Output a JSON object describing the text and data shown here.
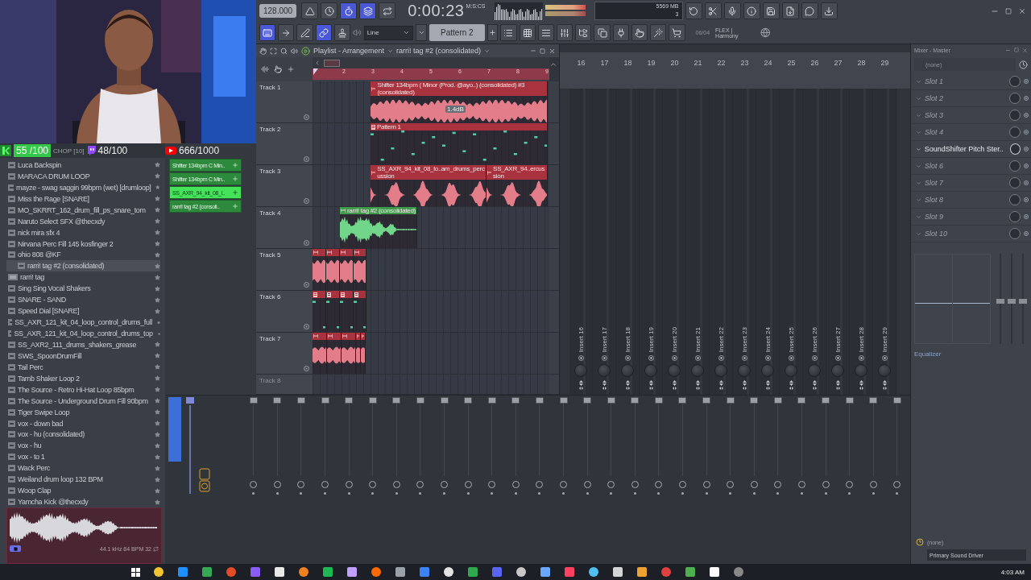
{
  "stats": {
    "kick_count": "55 /100",
    "hidden_label": "CHOP [10]",
    "twitch_count": "48/100",
    "youtube_count": "666/1000"
  },
  "toolbar": {
    "tempo": "128.000",
    "time": "0:00:23",
    "time_format": "M:S:CS",
    "cpu": "5",
    "memory": "569 MB",
    "polyphony": "3",
    "snap": "Line",
    "pattern": "Pattern 2",
    "news_date": "06/04",
    "news_text": "FLEX | Harmony",
    "row1_buttons": [
      {
        "kind": "metronome",
        "on": false
      },
      {
        "kind": "wait",
        "on": false
      },
      {
        "kind": "countdown",
        "on": true
      },
      {
        "kind": "overdub",
        "on": true
      },
      {
        "kind": "loop",
        "on": false
      }
    ],
    "row1_tools": [
      {
        "kind": "undo",
        "on": false
      },
      {
        "kind": "cut",
        "on": false
      },
      {
        "kind": "mic",
        "on": false
      },
      {
        "kind": "help",
        "on": false
      },
      {
        "kind": "save",
        "on": false
      },
      {
        "kind": "render",
        "on": false
      },
      {
        "kind": "chat",
        "on": false
      },
      {
        "kind": "download",
        "on": false
      }
    ],
    "row2_buttons": [
      {
        "kind": "keyboard",
        "on": true
      },
      {
        "kind": "step",
        "on": false
      },
      {
        "kind": "slide",
        "on": false
      },
      {
        "kind": "link",
        "on": true
      },
      {
        "kind": "stamp",
        "on": false
      }
    ],
    "row2_tools": [
      {
        "kind": "playlist",
        "on": false
      },
      {
        "kind": "piano_roll",
        "on": false
      },
      {
        "kind": "channel_rack",
        "on": false
      },
      {
        "kind": "mixer",
        "on": false
      },
      {
        "kind": "browser",
        "on": false
      },
      {
        "kind": "copy",
        "on": false
      },
      {
        "kind": "plug",
        "on": false
      },
      {
        "kind": "touch",
        "on": false
      },
      {
        "kind": "smart",
        "on": false
      },
      {
        "kind": "shop",
        "on": false
      }
    ]
  },
  "browser": {
    "items": [
      {
        "name": "Luca Backspin",
        "kind": "audio",
        "selected": false
      },
      {
        "name": "MARACA DRUM LOOP",
        "kind": "audio",
        "selected": false
      },
      {
        "name": "mayze - swag saggin 99bpm (wet) [drumloop]",
        "kind": "audio",
        "selected": false
      },
      {
        "name": "Miss the Rage [SNARE]",
        "kind": "audio",
        "selected": false
      },
      {
        "name": "MO_SKRRT_162_drum_fill_ps_snare_tom",
        "kind": "audio",
        "selected": false
      },
      {
        "name": "Naruto Select SFX @thecxdy",
        "kind": "audio",
        "selected": false
      },
      {
        "name": "nick mira sfx 4",
        "kind": "audio",
        "selected": false
      },
      {
        "name": "Nirvana Perc Fill 145 kosfinger 2",
        "kind": "audio",
        "selected": false
      },
      {
        "name": "ohio 808 @KF",
        "kind": "audio",
        "selected": false
      },
      {
        "name": "rarri! tag #2 (consolidated)",
        "kind": "audio",
        "selected": true
      },
      {
        "name": "rarri! tag",
        "kind": "mp3",
        "selected": false
      },
      {
        "name": "Sing Sing Vocal Shakers",
        "kind": "audio",
        "selected": false
      },
      {
        "name": "SNARE - SAND",
        "kind": "audio",
        "selected": false
      },
      {
        "name": "Speed Dial [SNARE]",
        "kind": "audio",
        "selected": false
      },
      {
        "name": "SS_AXR_121_kit_04_loop_control_drums_full",
        "kind": "audio",
        "selected": false
      },
      {
        "name": "SS_AXR_121_kit_04_loop_control_drums_top",
        "kind": "audio",
        "selected": false
      },
      {
        "name": "SS_AXR2_111_drums_shakers_grease",
        "kind": "audio",
        "selected": false
      },
      {
        "name": "SWS_SpoonDrumFill",
        "kind": "audio",
        "selected": false
      },
      {
        "name": "Tail Perc",
        "kind": "audio",
        "selected": false
      },
      {
        "name": "Tamb Shaker Loop 2",
        "kind": "audio",
        "selected": false
      },
      {
        "name": "The Source - Retro Hi-Hat Loop 85bpm",
        "kind": "audio",
        "selected": false
      },
      {
        "name": "The Source - Underground Drum Fill 90bpm",
        "kind": "audio",
        "selected": false
      },
      {
        "name": "Tiger Swipe Loop",
        "kind": "audio",
        "selected": false
      },
      {
        "name": "vox - down bad",
        "kind": "audio",
        "selected": false
      },
      {
        "name": "vox - hu (consolidated)",
        "kind": "audio",
        "selected": false
      },
      {
        "name": "vox - hu",
        "kind": "audio",
        "selected": false
      },
      {
        "name": "vox - to 1",
        "kind": "audio",
        "selected": false
      },
      {
        "name": "Wack Perc",
        "kind": "audio",
        "selected": false
      },
      {
        "name": "Weiland drum loop 132 BPM",
        "kind": "audio",
        "selected": false
      },
      {
        "name": "Woop Clap",
        "kind": "audio",
        "selected": false
      },
      {
        "name": "Yamcha Kick @thecxdy",
        "kind": "audio",
        "selected": false
      }
    ]
  },
  "preview": {
    "info": "44.1 kHz 84 BPM 32"
  },
  "channel_rack": {
    "clips": [
      {
        "label": "Shifter 134bpm C Min..",
        "selected": false
      },
      {
        "label": "Shifter 134bpm C Min..",
        "selected": false
      },
      {
        "label": "SS_AXR_94_kit_08_l..",
        "selected": true
      },
      {
        "label": "rarri! tag #2 (consoli..",
        "selected": false
      }
    ]
  },
  "playlist": {
    "title": "Playlist - Arrangement",
    "pattern": "rarri! tag #2 (consolidated)",
    "ruler": [
      "2",
      "3",
      "4",
      "5",
      "6",
      "7",
      "8",
      "9"
    ],
    "hint": "1.4dB",
    "tracks": [
      {
        "name": "Track 1",
        "clips": [
          {
            "kind": "audio",
            "label": "Shifter 134bpm ( Minor (Prod. @ayo..) (consolidated) #3 (consolidated)",
            "color": "#a8323e"
          }
        ]
      },
      {
        "name": "Track 2",
        "clips": [
          {
            "kind": "pattern",
            "label": "Pattern 1",
            "color": "#a8323e"
          }
        ]
      },
      {
        "name": "Track 3",
        "clips": [
          {
            "kind": "audio",
            "label": "SS_AXR_94_kit_08_lo..am_drums_percussion",
            "color": "#a8323e"
          },
          {
            "kind": "audio",
            "label": "SS_AXR_94..ercussion",
            "color": "#a8323e"
          }
        ]
      },
      {
        "name": "Track 4",
        "clips": [
          {
            "kind": "audio",
            "label": "rarri! tag #2 (consolidated)",
            "color": "#3f9a4c"
          }
        ]
      },
      {
        "name": "Track 5",
        "clips": [
          {
            "kind": "audio",
            "color": "#a8323e"
          },
          {
            "kind": "audio",
            "color": "#a8323e"
          },
          {
            "kind": "audio",
            "color": "#a8323e"
          },
          {
            "kind": "audio",
            "color": "#a8323e"
          }
        ]
      },
      {
        "name": "Track 6",
        "clips": [
          {
            "kind": "pattern",
            "color": "#a8323e"
          },
          {
            "kind": "pattern",
            "color": "#a8323e"
          },
          {
            "kind": "pattern",
            "color": "#a8323e"
          },
          {
            "kind": "pattern",
            "color": "#a8323e"
          }
        ]
      },
      {
        "name": "Track 7",
        "clips": [
          {
            "kind": "audio",
            "color": "#a8323e"
          },
          {
            "kind": "audio",
            "color": "#a8323e"
          },
          {
            "kind": "audio",
            "color": "#a8323e"
          },
          {
            "kind": "audio",
            "color": "#a8323e"
          },
          {
            "kind": "audio",
            "color": "#a8323e"
          }
        ]
      },
      {
        "name": "Track 8"
      }
    ]
  },
  "mixer": {
    "channels": [
      {
        "number": "16",
        "name": "Insert 16"
      },
      {
        "number": "17",
        "name": "Insert 17"
      },
      {
        "number": "18",
        "name": "Insert 18"
      },
      {
        "number": "19",
        "name": "Insert 19"
      },
      {
        "number": "20",
        "name": "Insert 20"
      },
      {
        "number": "21",
        "name": "Insert 21"
      },
      {
        "number": "22",
        "name": "Insert 22"
      },
      {
        "number": "23",
        "name": "Insert 23"
      },
      {
        "number": "24",
        "name": "Insert 24"
      },
      {
        "number": "25",
        "name": "Insert 25"
      },
      {
        "number": "26",
        "name": "Insert 26"
      },
      {
        "number": "27",
        "name": "Insert 27"
      },
      {
        "number": "28",
        "name": "Insert 28"
      },
      {
        "number": "29",
        "name": "Insert 29"
      }
    ]
  },
  "mixer_master": {
    "title": "Mixer - Master",
    "preset": "(none)",
    "equalizer": "Equalizer",
    "output": "(none)",
    "driver": "Primary Sound Driver",
    "slots": [
      {
        "name": "Slot 1",
        "loaded": false
      },
      {
        "name": "Slot 2",
        "loaded": false
      },
      {
        "name": "Slot 3",
        "loaded": false
      },
      {
        "name": "Slot 4",
        "loaded": false
      },
      {
        "name": "SoundShifter Pitch Ster..",
        "loaded": true
      },
      {
        "name": "Slot 6",
        "loaded": false
      },
      {
        "name": "Slot 7",
        "loaded": false
      },
      {
        "name": "Slot 8",
        "loaded": false
      },
      {
        "name": "Slot 9",
        "loaded": false
      },
      {
        "name": "Slot 10",
        "loaded": false
      }
    ]
  },
  "taskbar": {
    "clock": "4:03 AM"
  }
}
